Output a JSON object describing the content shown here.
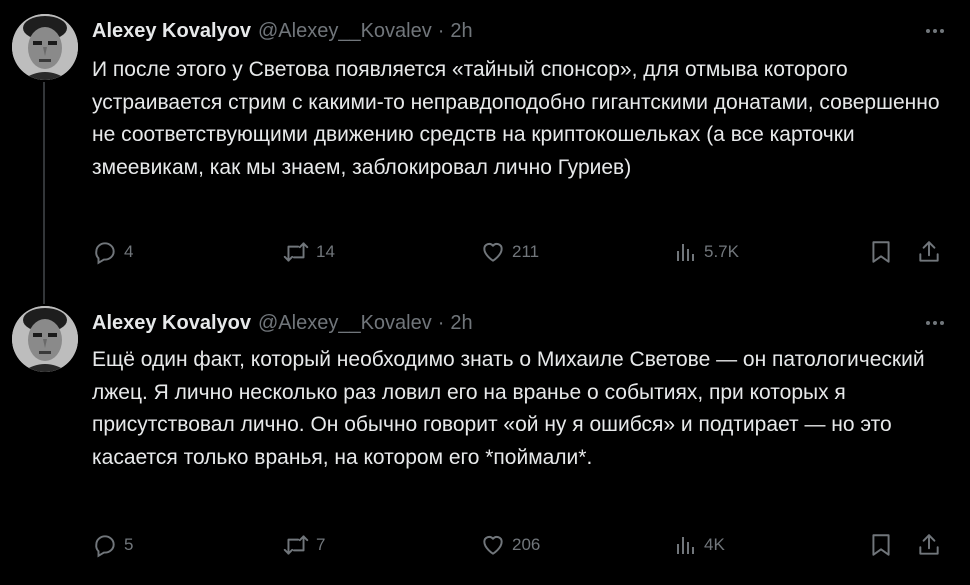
{
  "tweets": [
    {
      "author_name": "Alexey Kovalyov",
      "handle": "@Alexey__Kovalev",
      "separator": "·",
      "time": "2h",
      "text": "И после этого у Светова появляется «тайный спонсор», для отмыва которого устраивается стрим с какими-то неправдоподобно гигантскими донатами, совершенно не соответствующими движению средств на криптокошельках (а все карточки змеевикам, как мы знаем, заблокировал лично Гуриев)",
      "replies": "4",
      "retweets": "14",
      "likes": "211",
      "views": "5.7K"
    },
    {
      "author_name": "Alexey Kovalyov",
      "handle": "@Alexey__Kovalev",
      "separator": "·",
      "time": "2h",
      "text": "Ещё один факт, который необходимо знать о Михаиле Светове — он патологический лжец. Я лично несколько раз ловил его на вранье о событиях, при которых я присутствовал лично. Он обычно говорит «ой ну я ошибся» и подтирает — но это касается только вранья, на котором его *поймали*.",
      "replies": "5",
      "retweets": "7",
      "likes": "206",
      "views": "4K"
    }
  ],
  "icons": {
    "more": "more-horizontal-icon",
    "reply": "reply-bubble-icon",
    "retweet": "retweet-icon",
    "like": "heart-icon",
    "views": "analytics-bars-icon",
    "bookmark": "bookmark-icon",
    "share": "share-upload-icon"
  },
  "colors": {
    "background": "#000000",
    "text_primary": "#e7e9ea",
    "text_secondary": "#71767b",
    "thread_line": "#333639"
  }
}
